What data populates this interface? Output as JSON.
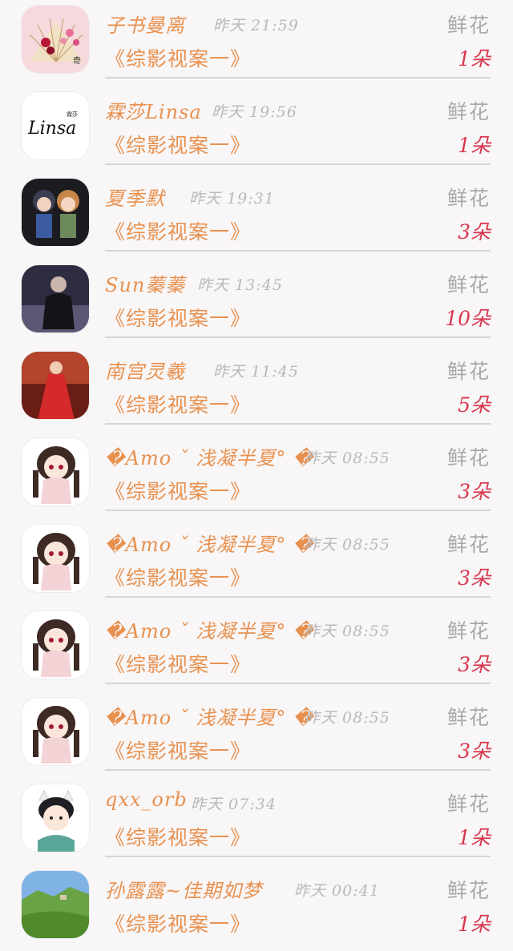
{
  "rows": [
    {
      "name": "子书曼离",
      "time": "昨天 21:59",
      "book": "《综影视案一》",
      "gift": "鲜花",
      "count": "1朵",
      "avatar": "fan-icon"
    },
    {
      "name": "霖莎Linsa",
      "time": "昨天 19:56",
      "book": "《综影视案一》",
      "gift": "鲜花",
      "count": "1朵",
      "avatar": "linsa-logo",
      "avatar_text": "Linsa",
      "avatar_small": "霖莎"
    },
    {
      "name": "夏季默",
      "time": "昨天 19:31",
      "book": "《综影视案一》",
      "gift": "鲜花",
      "count": "3朵",
      "avatar": "chibi-pair-avatar"
    },
    {
      "name": "Sun蓁蓁",
      "time": "昨天 13:45",
      "book": "《综影视案一》",
      "gift": "鲜花",
      "count": "10朵",
      "avatar": "dark-figure-avatar"
    },
    {
      "name": "南宫灵羲",
      "time": "昨天 11:45",
      "book": "《综影视案一》",
      "gift": "鲜花",
      "count": "5朵",
      "avatar": "red-dress-avatar"
    },
    {
      "name": "�Amo ˇ 浅凝半夏° �",
      "time": "昨天 08:55",
      "book": "《综影视案一》",
      "gift": "鲜花",
      "count": "3朵",
      "avatar": "anime-girl-avatar"
    },
    {
      "name": "�Amo ˇ 浅凝半夏° �",
      "time": "昨天 08:55",
      "book": "《综影视案一》",
      "gift": "鲜花",
      "count": "3朵",
      "avatar": "anime-girl-avatar"
    },
    {
      "name": "�Amo ˇ 浅凝半夏° �",
      "time": "昨天 08:55",
      "book": "《综影视案一》",
      "gift": "鲜花",
      "count": "3朵",
      "avatar": "anime-girl-avatar"
    },
    {
      "name": "�Amo ˇ 浅凝半夏° �",
      "time": "昨天 08:55",
      "book": "《综影视案一》",
      "gift": "鲜花",
      "count": "3朵",
      "avatar": "anime-girl-avatar"
    },
    {
      "name": "qxx_orb",
      "time": "昨天 07:34",
      "book": "《综影视案一》",
      "gift": "鲜花",
      "count": "1朵",
      "avatar": "cartoon-boy-avatar"
    },
    {
      "name": "孙露露~佳期如梦",
      "time": "昨天 00:41",
      "book": "《综影视案一》",
      "gift": "鲜花",
      "count": "1朵",
      "avatar": "landscape-avatar"
    }
  ],
  "colors": {
    "name": "#e8914f",
    "time": "#b9b9b9",
    "gift": "#a9a9a9",
    "count": "#d8374f",
    "divider": "#d6d6d6",
    "background": "#f8f6f7"
  }
}
